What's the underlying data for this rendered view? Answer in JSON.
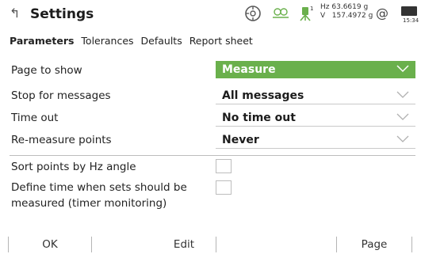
{
  "header": {
    "title": "Settings",
    "hz_label": "Hz",
    "hz_value": "63.6619 g",
    "v_label": "V",
    "v_value": "157.4972 g",
    "at_symbol": "@",
    "time": "15:34",
    "accent_color": "#6ab04c"
  },
  "tabs": [
    "Parameters",
    "Tolerances",
    "Defaults",
    "Report sheet"
  ],
  "active_tab": "Parameters",
  "settings": {
    "page_to_show": {
      "label": "Page to show",
      "value": "Measure"
    },
    "stop_for_messages": {
      "label": "Stop for messages",
      "value": "All messages"
    },
    "time_out": {
      "label": "Time out",
      "value": "No time out"
    },
    "remeasure_points": {
      "label": "Re-measure points",
      "value": "Never"
    },
    "sort_points": {
      "label": "Sort points by Hz angle",
      "checked": false
    },
    "define_time_line1": "Define time when sets should be",
    "define_time_line2": "measured (timer monitoring)",
    "define_time_checked": false
  },
  "softkeys": {
    "ok": "OK",
    "edit": "Edit",
    "page": "Page"
  }
}
